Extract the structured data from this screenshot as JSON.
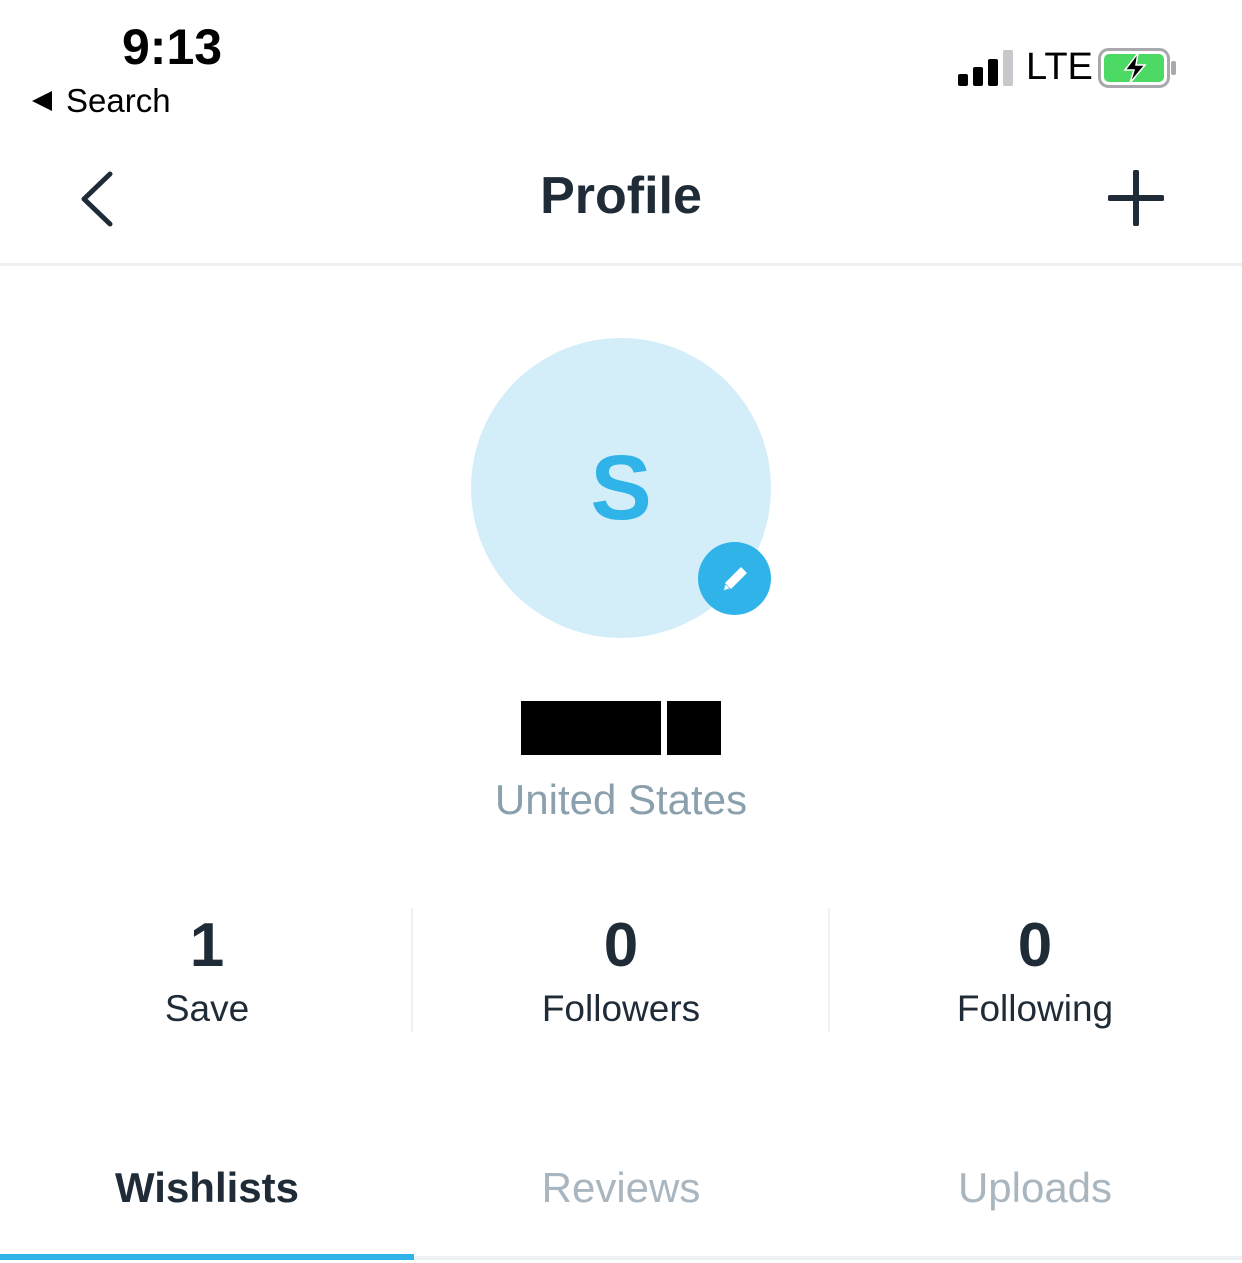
{
  "status_bar": {
    "time": "9:13",
    "back_app_label": "Search",
    "network": "LTE",
    "icons": [
      "signal-icon",
      "battery-charging-icon"
    ]
  },
  "nav": {
    "title": "Profile",
    "icons": [
      "back-chevron-icon",
      "plus-icon"
    ]
  },
  "profile": {
    "avatar_initial": "S",
    "location": "United States",
    "edit_icon": "pencil-icon"
  },
  "stats": [
    {
      "value": "1",
      "label": "Save"
    },
    {
      "value": "0",
      "label": "Followers"
    },
    {
      "value": "0",
      "label": "Following"
    }
  ],
  "tabs": [
    {
      "label": "Wishlists",
      "active": true
    },
    {
      "label": "Reviews",
      "active": false
    },
    {
      "label": "Uploads",
      "active": false
    }
  ],
  "colors": {
    "accent": "#2fb3e8",
    "avatar_bg": "#d4eef9",
    "text_primary": "#1f2b36",
    "text_muted": "#8aa0ad",
    "tab_inactive": "#a9b6bf",
    "battery_green": "#4cd964"
  }
}
